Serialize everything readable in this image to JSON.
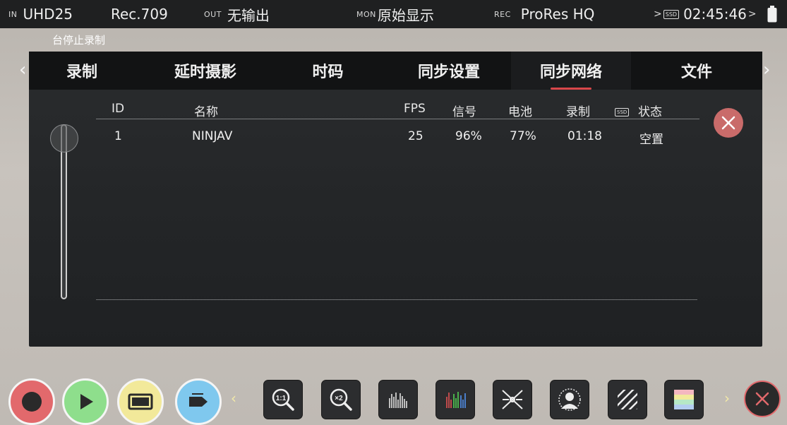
{
  "topbar": {
    "in_label": "IN",
    "in_value": "UHD25",
    "colorspace": "Rec.709",
    "out_label": "OUT",
    "out_value": "无输出",
    "mon_label": "MON",
    "mon_value": "原始显示",
    "rec_label": "REC",
    "rec_value": "ProRes HQ",
    "ssd_label": "SSD",
    "timecode": "02:45:46"
  },
  "status_message": "台停止录制",
  "tabs": [
    {
      "label": "录制",
      "active": false
    },
    {
      "label": "延时摄影",
      "active": false
    },
    {
      "label": "时码",
      "active": false
    },
    {
      "label": "同步设置",
      "active": false
    },
    {
      "label": "同步网络",
      "active": true
    },
    {
      "label": "文件",
      "active": false
    }
  ],
  "table": {
    "headers": {
      "id": "ID",
      "name": "名称",
      "fps": "FPS",
      "signal": "信号",
      "battery": "电池",
      "record": "录制",
      "ssd": "SSD",
      "status": "状态"
    },
    "rows": [
      {
        "id": "1",
        "name": "NINJAV",
        "fps": "25",
        "signal": "96%",
        "battery": "77%",
        "record": "01:18",
        "status": "空置"
      }
    ]
  },
  "slider": {
    "position": 0.0
  },
  "icons": {
    "record": "record-icon",
    "play": "play-icon",
    "display": "monitor-icon",
    "tag": "tag-icon",
    "zoom_1x": "zoom-1x-icon",
    "zoom_2x": "zoom-2x-icon",
    "waveform": "waveform-icon",
    "rgb_parade": "rgb-parade-icon",
    "focus_peaking": "focus-peaking-icon",
    "false_color": "false-color-icon",
    "zebra": "zebra-icon",
    "color_bars": "color-bars-icon",
    "close": "close-icon"
  },
  "colors": {
    "accent": "#d9474a",
    "record_button": "#e2696c",
    "play_button": "#8ede8c",
    "display_button": "#f2e99a",
    "tag_button": "#7fc8ee"
  }
}
